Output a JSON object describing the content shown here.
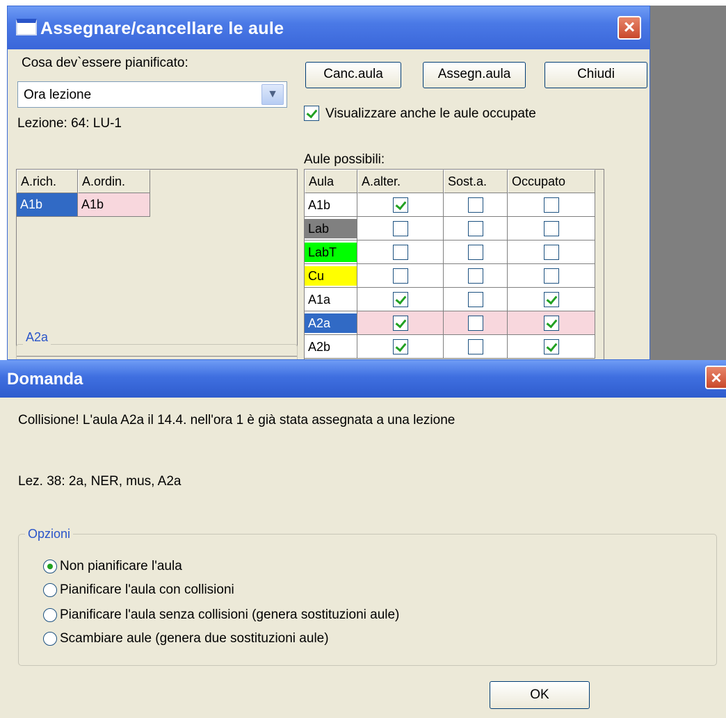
{
  "background_dialog": {
    "title": "Assegnare/cancellare le aule",
    "planned_label": "Cosa dev`essere pianificato:",
    "planned_value": "Ora lezione",
    "lesson_label": "Lezione: 64: LU-1",
    "buttons": {
      "canc": "Canc.aula",
      "assegn": "Assegn.aula",
      "chiudi": "Chiudi"
    },
    "show_occupied": {
      "label": "Visualizzare anche le aule occupate",
      "checked": true
    },
    "possible_rooms_label": "Aule possibili:",
    "left_table": {
      "headers": [
        "A.rich.",
        "A.ordin."
      ],
      "rows": [
        [
          "A1b",
          "A1b"
        ]
      ]
    },
    "fieldset_label": "A2a",
    "rooms_table": {
      "headers": [
        "Aula",
        "A.alter.",
        "Sost.a.",
        "Occupato"
      ],
      "rows": [
        {
          "aula": "A1b",
          "alter": true,
          "sost": false,
          "occupato": false,
          "color": "#ffffff"
        },
        {
          "aula": "Lab",
          "alter": false,
          "sost": false,
          "occupato": false,
          "color": "#808080"
        },
        {
          "aula": "LabT",
          "alter": false,
          "sost": false,
          "occupato": false,
          "color": "#00ff00"
        },
        {
          "aula": "Cu",
          "alter": false,
          "sost": false,
          "occupato": false,
          "color": "#ffff00"
        },
        {
          "aula": "A1a",
          "alter": true,
          "sost": false,
          "occupato": true,
          "color": "#ffffff"
        },
        {
          "aula": "A2a",
          "alter": true,
          "sost": false,
          "occupato": true,
          "color": "#316ac5",
          "selected": true
        },
        {
          "aula": "A2b",
          "alter": true,
          "sost": false,
          "occupato": true,
          "color": "#ffffff"
        }
      ]
    },
    "colors": {
      "selection": "#316ac5",
      "highlight_row": "#f8d7dd"
    }
  },
  "question_dialog": {
    "title": "Domanda",
    "message": "Collisione! L'aula A2a il 14.4. nell'ora 1 è già stata assegnata a una lezione",
    "lesson_detail": "Lez. 38: 2a, NER, mus, A2a",
    "options_label": "Opzioni",
    "options": [
      {
        "label": "Non pianificare l'aula",
        "selected": true
      },
      {
        "label": "Pianificare l'aula con collisioni",
        "selected": false
      },
      {
        "label": "Pianificare l'aula senza collisioni (genera sostituzioni aule)",
        "selected": false
      },
      {
        "label": "Scambiare aule (genera due sostituzioni aule)",
        "selected": false
      }
    ],
    "ok_label": "OK"
  }
}
